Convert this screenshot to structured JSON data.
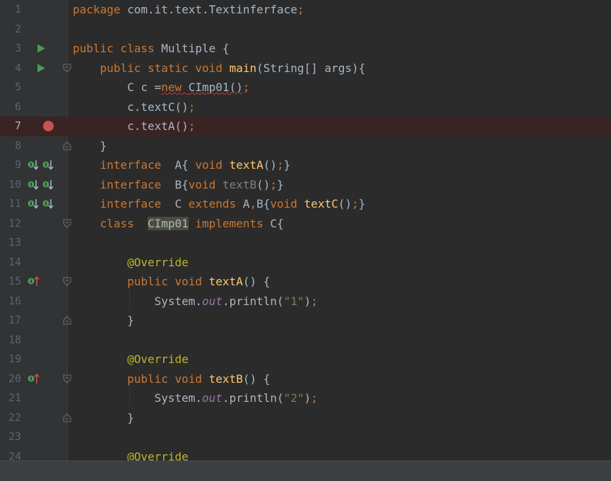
{
  "editor": {
    "lines": [
      {
        "n": "1",
        "tokens": [
          {
            "t": "package ",
            "c": "kw"
          },
          {
            "t": "com.it.text.Textinferface",
            "c": "pl"
          },
          {
            "t": ";",
            "c": "kw"
          }
        ]
      },
      {
        "n": "2",
        "tokens": []
      },
      {
        "n": "3",
        "run": true,
        "tokens": [
          {
            "t": "public class ",
            "c": "kw"
          },
          {
            "t": "Multiple {",
            "c": "pl"
          }
        ]
      },
      {
        "n": "4",
        "run": true,
        "fold": "start",
        "tokens": [
          {
            "t": "    "
          },
          {
            "t": "public static void ",
            "c": "kw"
          },
          {
            "t": "main",
            "c": "fn"
          },
          {
            "t": "(String[] args){",
            "c": "pl"
          }
        ]
      },
      {
        "n": "5",
        "tokens": [
          {
            "t": "        C c =",
            "c": "pl"
          },
          {
            "t": "new ",
            "c": "kw err"
          },
          {
            "t": "CImp01()",
            "c": "pl err"
          },
          {
            "t": ";",
            "c": "kw"
          }
        ]
      },
      {
        "n": "6",
        "tokens": [
          {
            "t": "        c.",
            "c": "pl"
          },
          {
            "t": "textC",
            "c": "pl"
          },
          {
            "t": "()",
            "c": "pl"
          },
          {
            "t": ";",
            "c": "kw"
          }
        ]
      },
      {
        "n": "7",
        "breakpoint": true,
        "tokens": [
          {
            "t": "        c.textA()",
            "c": "pl"
          },
          {
            "t": ";",
            "c": "kw"
          }
        ]
      },
      {
        "n": "8",
        "fold": "end",
        "tokens": [
          {
            "t": "    }",
            "c": "pl"
          }
        ]
      },
      {
        "n": "9",
        "markers": "impl",
        "tokens": [
          {
            "t": "    "
          },
          {
            "t": "interface  ",
            "c": "kw"
          },
          {
            "t": "A{ ",
            "c": "pl"
          },
          {
            "t": "void ",
            "c": "kw"
          },
          {
            "t": "textA",
            "c": "fn"
          },
          {
            "t": "()",
            "c": "pl"
          },
          {
            "t": ";",
            "c": "kw"
          },
          {
            "t": "}",
            "c": "pl"
          }
        ]
      },
      {
        "n": "10",
        "markers": "impl",
        "tokens": [
          {
            "t": "    "
          },
          {
            "t": "interface  ",
            "c": "kw"
          },
          {
            "t": "B{",
            "c": "pl"
          },
          {
            "t": "void ",
            "c": "kw"
          },
          {
            "t": "textB",
            "c": "dim"
          },
          {
            "t": "()",
            "c": "pl"
          },
          {
            "t": ";",
            "c": "kw"
          },
          {
            "t": "}",
            "c": "pl"
          }
        ]
      },
      {
        "n": "11",
        "markers": "impl",
        "tokens": [
          {
            "t": "    "
          },
          {
            "t": "interface  ",
            "c": "kw"
          },
          {
            "t": "C ",
            "c": "pl"
          },
          {
            "t": "extends ",
            "c": "kw"
          },
          {
            "t": "A",
            "c": "pl"
          },
          {
            "t": ",",
            "c": "kw"
          },
          {
            "t": "B{",
            "c": "pl"
          },
          {
            "t": "void ",
            "c": "kw"
          },
          {
            "t": "textC",
            "c": "fn"
          },
          {
            "t": "()",
            "c": "pl"
          },
          {
            "t": ";",
            "c": "kw"
          },
          {
            "t": "}",
            "c": "pl"
          }
        ]
      },
      {
        "n": "12",
        "fold": "start",
        "tokens": [
          {
            "t": "    "
          },
          {
            "t": "class  ",
            "c": "kw"
          },
          {
            "t": "CImp01",
            "c": "pl hl"
          },
          {
            "t": " "
          },
          {
            "t": "implements ",
            "c": "kw"
          },
          {
            "t": "C{",
            "c": "pl"
          }
        ]
      },
      {
        "n": "13",
        "tokens": []
      },
      {
        "n": "14",
        "tokens": [
          {
            "t": "        "
          },
          {
            "t": "@Override",
            "c": "ann"
          }
        ]
      },
      {
        "n": "15",
        "markers": "override",
        "fold": "start",
        "tokens": [
          {
            "t": "        "
          },
          {
            "t": "public void ",
            "c": "kw"
          },
          {
            "t": "textA",
            "c": "fn"
          },
          {
            "t": "() {",
            "c": "pl"
          }
        ]
      },
      {
        "n": "16",
        "tokens": [
          {
            "t": "            System.",
            "c": "pl"
          },
          {
            "t": "out",
            "c": "st"
          },
          {
            "t": ".println(",
            "c": "pl"
          },
          {
            "t": "\"1\"",
            "c": "str"
          },
          {
            "t": ")",
            "c": "pl"
          },
          {
            "t": ";",
            "c": "kw"
          }
        ]
      },
      {
        "n": "17",
        "fold": "end",
        "tokens": [
          {
            "t": "        }",
            "c": "pl"
          }
        ]
      },
      {
        "n": "18",
        "tokens": []
      },
      {
        "n": "19",
        "tokens": [
          {
            "t": "        "
          },
          {
            "t": "@Override",
            "c": "ann"
          }
        ]
      },
      {
        "n": "20",
        "markers": "override",
        "fold": "start",
        "tokens": [
          {
            "t": "        "
          },
          {
            "t": "public void ",
            "c": "kw"
          },
          {
            "t": "textB",
            "c": "fn"
          },
          {
            "t": "() {",
            "c": "pl"
          }
        ]
      },
      {
        "n": "21",
        "tokens": [
          {
            "t": "            System.",
            "c": "pl"
          },
          {
            "t": "out",
            "c": "st"
          },
          {
            "t": ".println(",
            "c": "pl"
          },
          {
            "t": "\"2\"",
            "c": "str"
          },
          {
            "t": ")",
            "c": "pl"
          },
          {
            "t": ";",
            "c": "kw"
          }
        ]
      },
      {
        "n": "22",
        "fold": "end",
        "tokens": [
          {
            "t": "        }",
            "c": "pl"
          }
        ]
      },
      {
        "n": "23",
        "tokens": []
      },
      {
        "n": "24",
        "tokens": [
          {
            "t": "        "
          },
          {
            "t": "@Override",
            "c": "ann"
          }
        ]
      }
    ]
  },
  "icons": {
    "run": "run-gutter-icon",
    "breakpoint": "breakpoint-icon",
    "implemented": "implemented-gutter-icon",
    "override": "overrides-method-gutter-icon",
    "fold": "fold-marker-icon"
  },
  "colors": {
    "background": "#2b2b2b",
    "gutter": "#313335",
    "keyword": "#cc7832",
    "method": "#ffc66d",
    "annotation": "#bbb529",
    "string": "#6a8759",
    "breakpoint": "#c75450",
    "breakpoint_line": "#3a2323",
    "run_icon": "#499c54"
  }
}
